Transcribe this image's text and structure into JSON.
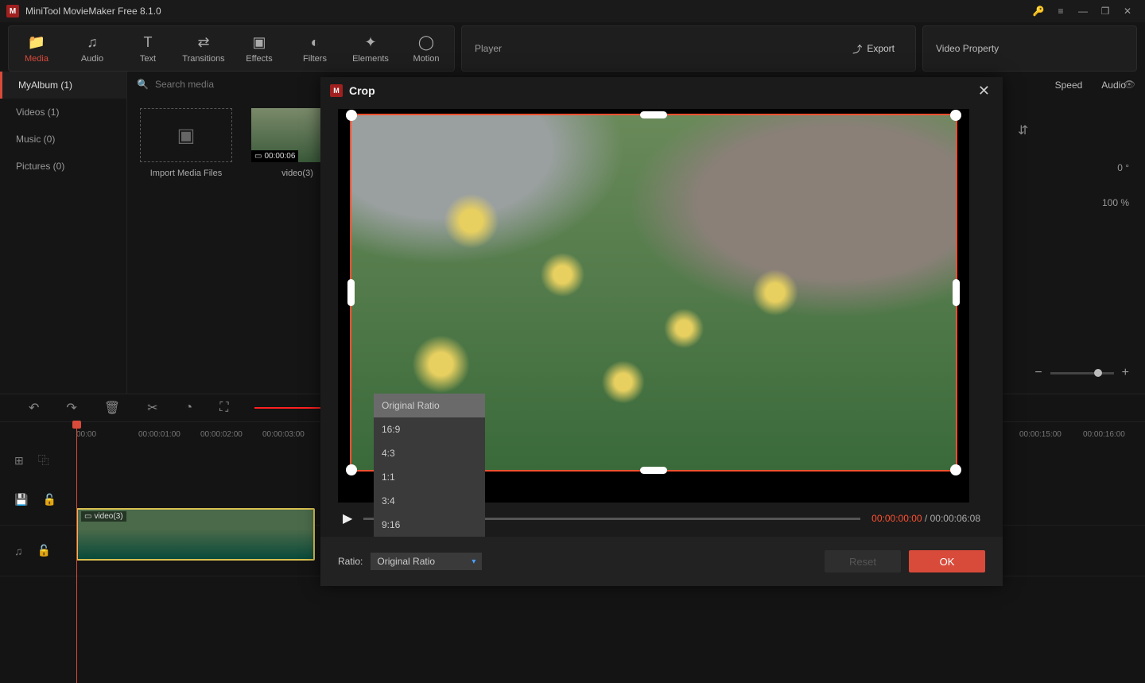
{
  "app": {
    "title": "MiniTool MovieMaker Free 8.1.0"
  },
  "nav": {
    "media": "Media",
    "audio": "Audio",
    "text": "Text",
    "transitions": "Transitions",
    "effects": "Effects",
    "filters": "Filters",
    "elements": "Elements",
    "motion": "Motion"
  },
  "player": {
    "label": "Player",
    "export": "Export"
  },
  "video_property": {
    "title": "Video Property"
  },
  "sidebar": {
    "items": [
      "MyAlbum (1)",
      "Videos (1)",
      "Music (0)",
      "Pictures (0)"
    ]
  },
  "search": {
    "placeholder": "Search media"
  },
  "media": {
    "import_caption": "Import Media Files",
    "clip_name": "video(3)",
    "clip_duration": "00:00:06"
  },
  "right_tabs": {
    "speed": "Speed",
    "audio": "Audio"
  },
  "right_values": {
    "rotate": "0 °",
    "scale": "100 %"
  },
  "ruler": [
    "00:00",
    "00:00:01:00",
    "00:00:02:00",
    "00:00:03:00",
    "00:00:15:00",
    "00:00:16:00"
  ],
  "timeline_clip": "video(3)",
  "crop": {
    "title": "Crop",
    "ratio_label": "Ratio:",
    "ratio_selected": "Original Ratio",
    "options": [
      "Original Ratio",
      "16:9",
      "4:3",
      "1:1",
      "3:4",
      "9:16"
    ],
    "current_time": "00:00:00:00",
    "separator": " / ",
    "total_time": "00:00:06:08",
    "reset": "Reset",
    "ok": "OK"
  }
}
